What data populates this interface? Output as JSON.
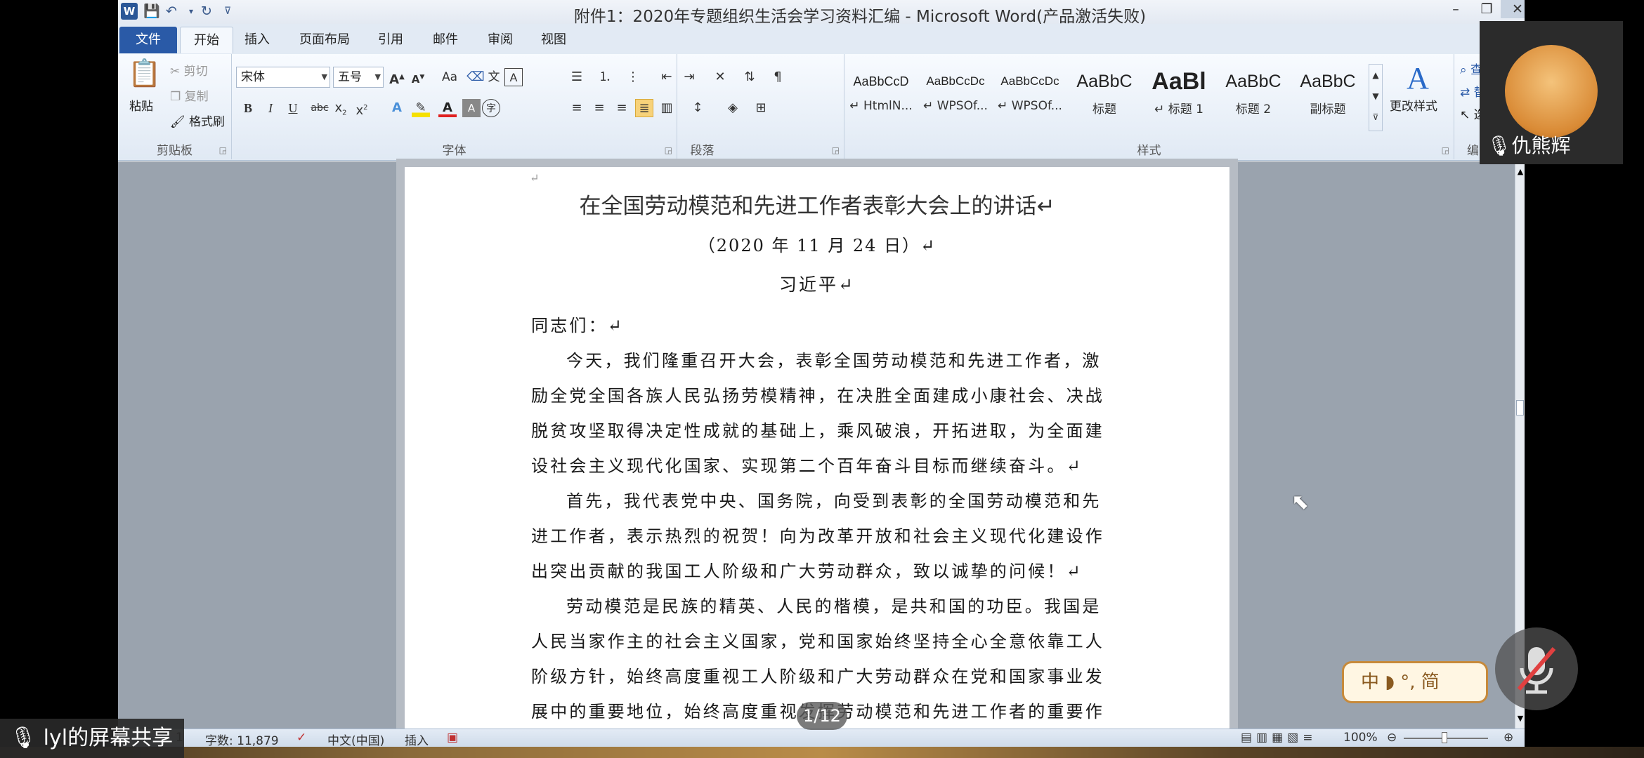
{
  "window": {
    "title": "附件1：2020年专题组织生活会学习资料汇编 - Microsoft Word(产品激活失败)"
  },
  "tabs": [
    "文件",
    "开始",
    "插入",
    "页面布局",
    "引用",
    "邮件",
    "审阅",
    "视图"
  ],
  "clipboard": {
    "paste": "粘贴",
    "cut": "剪切",
    "copy": "复制",
    "format_painter": "格式刷",
    "label": "剪贴板"
  },
  "font": {
    "name": "宋体",
    "size": "五号",
    "label": "字体",
    "case_btn": "Aa"
  },
  "paragraph": {
    "label": "段落"
  },
  "styles": {
    "label": "样式",
    "items": [
      {
        "preview": "AaBbCcD",
        "name": "↵ HtmlN..."
      },
      {
        "preview": "AaBbCcDc",
        "name": "↵ WPSOf..."
      },
      {
        "preview": "AaBbCcDc",
        "name": "↵ WPSOf..."
      },
      {
        "preview": "AaBbC",
        "name": "标题"
      },
      {
        "preview": "AaBl",
        "name": "↵ 标题 1"
      },
      {
        "preview": "AaBbC",
        "name": "标题 2"
      },
      {
        "preview": "AaBbC",
        "name": "副标题"
      }
    ],
    "change_styles": "更改样式"
  },
  "editing": {
    "find": "查",
    "replace": "替",
    "select": "选",
    "label": "编"
  },
  "document": {
    "title": "在全国劳动模范和先进工作者表彰大会上的讲话↵",
    "date": "（2020 年 11 月 24 日）↵",
    "author": "习近平↵",
    "salutation": "同志们：↵",
    "lines": [
      "今天，我们隆重召开大会，表彰全国劳动模范和先进工作者，激",
      "励全党全国各族人民弘扬劳模精神，在决胜全面建成小康社会、决战",
      "脱贫攻坚取得决定性成就的基础上，乘风破浪，开拓进取，为全面建",
      "设社会主义现代化国家、实现第二个百年奋斗目标而继续奋斗。↵",
      "首先，我代表党中央、国务院，向受到表彰的全国劳动模范和先",
      "进工作者，表示热烈的祝贺！向为改革开放和社会主义现代化建设作",
      "出突出贡献的我国工人阶级和广大劳动群众，致以诚挚的问候！↵",
      "劳动模范是民族的精英、人民的楷模，是共和国的功臣。我国是",
      "人民当家作主的社会主义国家，党和国家始终坚持全心全意依靠工人",
      "阶级方针，始终高度重视工人阶级和广大劳动群众在党和国家事业发",
      "展中的重要地位，始终高度重视发挥劳动模范和先进工作者的重要作"
    ]
  },
  "status": {
    "page_fragment": "1",
    "word_count": "字数: 11,879",
    "language": "中文(中国)",
    "mode": "插入",
    "zoom": "100%"
  },
  "overlay": {
    "screen_share": "lyl的屏幕共享",
    "page_indicator": "1/12",
    "speaker_name": "仇熊辉",
    "ime": "中 ◗ °, 简"
  }
}
